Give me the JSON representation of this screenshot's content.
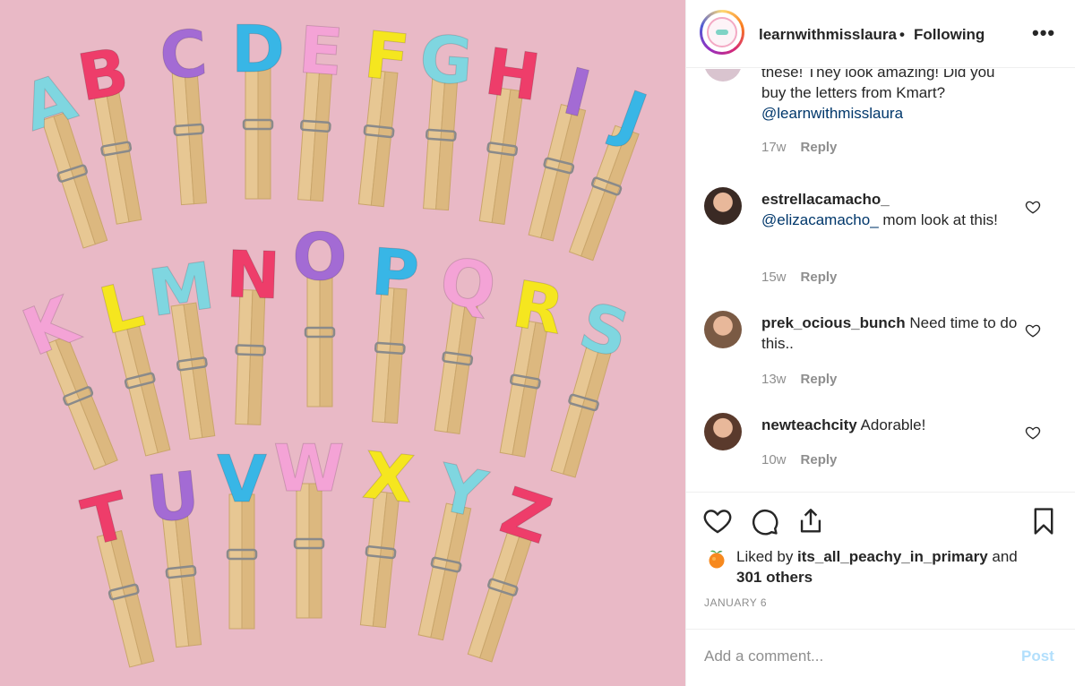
{
  "header": {
    "username": "learnwithmisslaura",
    "separator": "•",
    "follow_status": "Following",
    "more_label": "•••"
  },
  "comments": [
    {
      "text": "these! They look amazing! Did you buy the letters from Kmart?",
      "mention": "@learnwithmisslaura",
      "age": "17w",
      "reply": "Reply"
    },
    {
      "username": "estrellacamacho_",
      "mention": "@elizacamacho_",
      "text": " mom look at this!",
      "age": "15w",
      "reply": "Reply",
      "avatar_color": "#3a2a24"
    },
    {
      "username": "prek_ocious_bunch",
      "text": " Need time to do this..",
      "age": "13w",
      "reply": "Reply",
      "avatar_color": "#7a5a44"
    },
    {
      "username": "newteachcity",
      "text": " Adorable!",
      "age": "10w",
      "reply": "Reply",
      "avatar_color": "#5a3a2c"
    }
  ],
  "likes": {
    "prefix": "Liked by ",
    "user": "its_all_peachy_in_primary",
    "middle": " and ",
    "count": "301 others"
  },
  "post_date": "JANUARY 6",
  "add_comment": {
    "placeholder": "Add a comment...",
    "post_label": "Post"
  },
  "photo": {
    "background": "#e9b9c6",
    "letters": [
      "A",
      "B",
      "C",
      "D",
      "E",
      "F",
      "G",
      "H",
      "I",
      "J",
      "K",
      "L",
      "M",
      "N",
      "O",
      "P",
      "Q",
      "R",
      "S",
      "T",
      "U",
      "V",
      "W",
      "X",
      "Y",
      "Z"
    ],
    "letter_colors": {
      "A": "#7fd6e0",
      "B": "#ee3d6a",
      "C": "#a36bd4",
      "D": "#38b6e6",
      "E": "#f4a3d6",
      "F": "#f5e61f",
      "G": "#7fd6e0",
      "H": "#ee3d6a",
      "I": "#a36bd4",
      "J": "#38b6e6",
      "K": "#f4a3d6",
      "L": "#f5e61f",
      "M": "#7fd6e0",
      "N": "#ee3d6a",
      "O": "#a36bd4",
      "P": "#38b6e6",
      "Q": "#f4a3d6",
      "R": "#f5e61f",
      "S": "#7fd6e0",
      "T": "#ee3d6a",
      "U": "#a36bd4",
      "V": "#38b6e6",
      "W": "#f4a3d6",
      "X": "#f5e61f",
      "Y": "#7fd6e0",
      "Z": "#ee3d6a"
    }
  }
}
